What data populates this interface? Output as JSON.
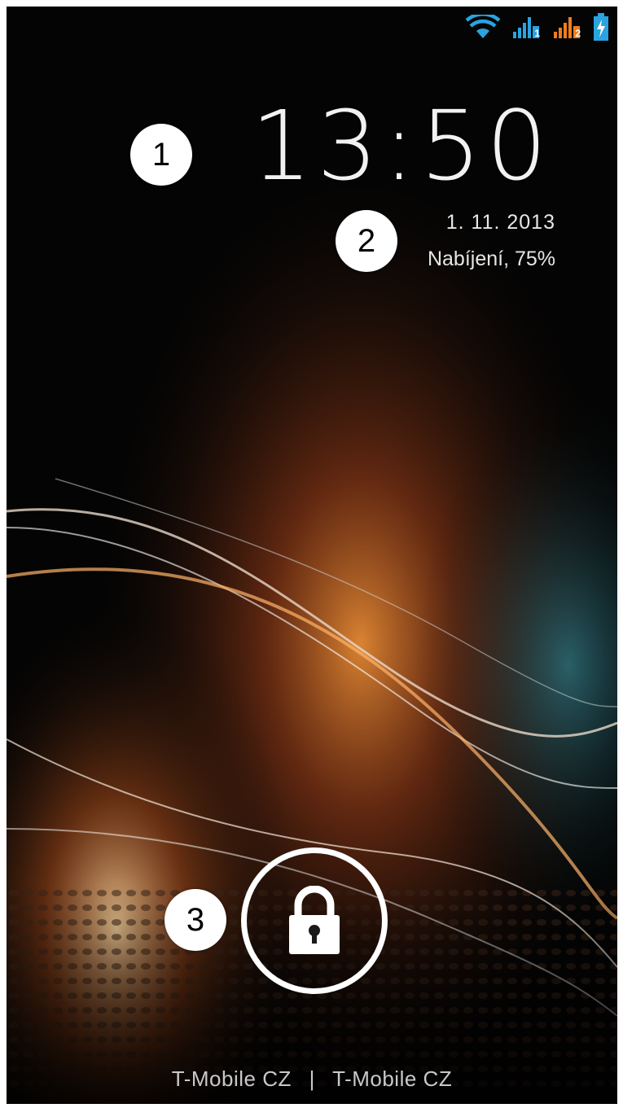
{
  "status_bar": {
    "icons": [
      "wifi-icon",
      "signal-sim1-icon",
      "signal-sim2-icon",
      "battery-charging-icon"
    ],
    "sim1_label": "1",
    "sim2_label": "2",
    "colors": {
      "wifi": "#2aa3e0",
      "sim1": "#2aa3e0",
      "sim2": "#f07c1e",
      "battery": "#2aa3e0"
    }
  },
  "lockscreen": {
    "time": "13:50",
    "date": "1. 11. 2013",
    "battery_status": "Nabíjení, 75%",
    "unlock_icon": "padlock-icon"
  },
  "carriers": {
    "sim1": "T-Mobile CZ",
    "separator": "|",
    "sim2": "T-Mobile CZ"
  },
  "annotations": {
    "marker_1": "1",
    "marker_2": "2",
    "marker_3": "3"
  }
}
